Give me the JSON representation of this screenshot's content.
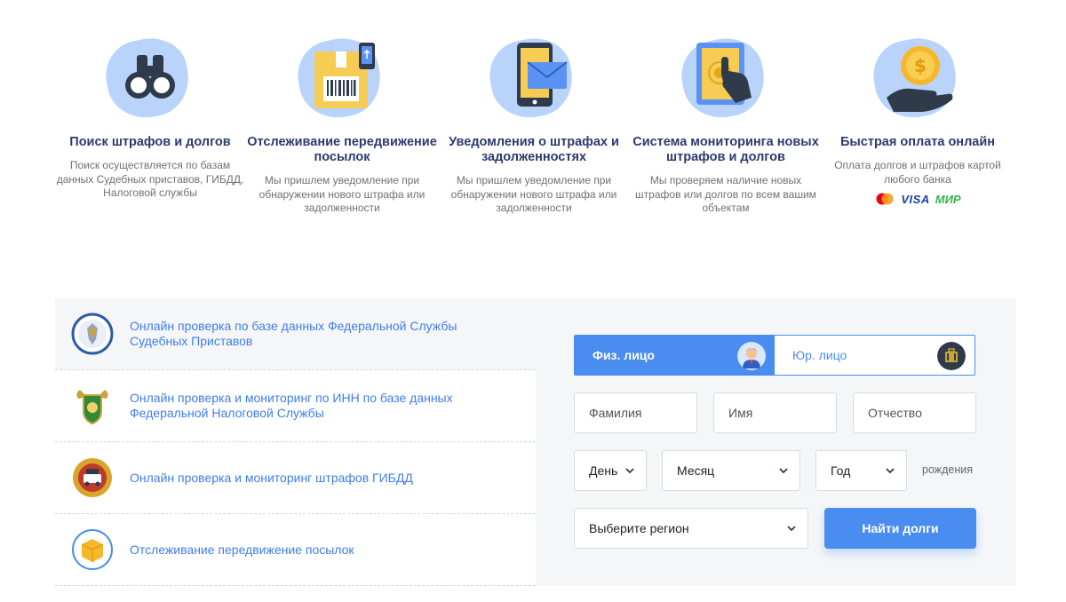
{
  "features": [
    {
      "title": "Поиск штрафов и долгов",
      "desc": "Поиск осуществляется по базам данных Судебных приставов, ГИБДД, Налоговой службы",
      "icon": "binoculars-icon"
    },
    {
      "title": "Отслеживание передвижение посылок",
      "desc": "Мы пришлем уведомление при обнаружении нового штрафа или задолженности",
      "icon": "parcel-barcode-icon"
    },
    {
      "title": "Уведомления о штрафах и задолженностях",
      "desc": "Мы пришлем уведомление при обнаружении нового штрафа или задолженности",
      "icon": "phone-mail-icon"
    },
    {
      "title": "Система мониторинга новых штрафов и долгов",
      "desc": "Мы проверяем наличие новых штрафов или долгов по всем вашим объектам",
      "icon": "tablet-touch-icon"
    },
    {
      "title": "Быстрая оплата онлайн",
      "desc": "Оплата долгов и штрафов картой любого банка",
      "icon": "coin-hand-icon",
      "payments": {
        "visa": "VISA",
        "mir": "МИР"
      }
    }
  ],
  "services": [
    {
      "label": "Онлайн проверка по базе данных Федеральной Службы Судебных Приставов",
      "icon": "fssp-emblem-icon"
    },
    {
      "label": "Онлайн проверка и мониторинг по ИНН по базе данных Федеральной Налоговой Службы",
      "icon": "fns-emblem-icon"
    },
    {
      "label": "Онлайн проверка и мониторинг штрафов ГИБДД",
      "icon": "gibdd-emblem-icon"
    },
    {
      "label": "Отслеживание передвижение посылок",
      "icon": "parcel-box-icon"
    }
  ],
  "form": {
    "tab_individual": "Физ. лицо",
    "tab_legal": "Юр. лицо",
    "lastname_placeholder": "Фамилия",
    "firstname_placeholder": "Имя",
    "middlename_placeholder": "Отчество",
    "day": "День",
    "month": "Месяц",
    "year": "Год",
    "birth_label": "рождения",
    "region": "Выберите регион",
    "submit": "Найти долги"
  },
  "colors": {
    "accent": "#4a8df0",
    "title": "#2c3a6e",
    "panel": "#f5f6f8"
  }
}
